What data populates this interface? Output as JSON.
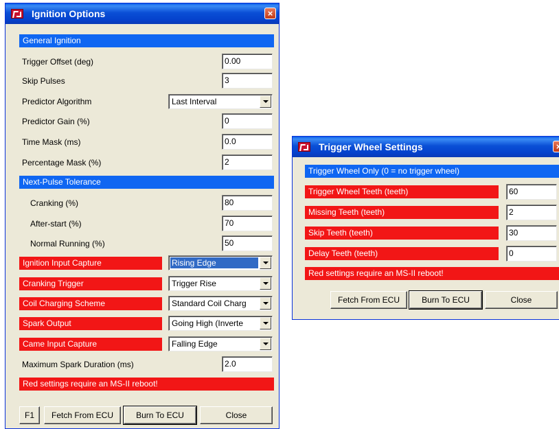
{
  "ignition": {
    "title": "Ignition Options",
    "close_glyph": "×",
    "general_header": "General Ignition",
    "trigger_offset": {
      "label": "Trigger Offset (deg)",
      "value": "0.00"
    },
    "skip_pulses": {
      "label": "Skip Pulses",
      "value": "3"
    },
    "predictor_algorithm": {
      "label": "Predictor Algorithm",
      "value": "Last Interval"
    },
    "predictor_gain": {
      "label": "Predictor Gain (%)",
      "value": "0"
    },
    "time_mask": {
      "label": "Time Mask (ms)",
      "value": "0.0"
    },
    "percentage_mask": {
      "label": "Percentage Mask (%)",
      "value": "2"
    },
    "tolerance_header": "Next-Pulse Tolerance",
    "cranking": {
      "label": "Cranking (%)",
      "value": "80"
    },
    "after_start": {
      "label": "After-start (%)",
      "value": "70"
    },
    "normal_running": {
      "label": "Normal Running (%)",
      "value": "50"
    },
    "ignition_input_capture": {
      "label": "Ignition Input Capture",
      "value": "Rising Edge"
    },
    "cranking_trigger": {
      "label": "Cranking Trigger",
      "value": "Trigger Rise"
    },
    "coil_charging_scheme": {
      "label": "Coil Charging Scheme",
      "value": "Standard Coil Charg"
    },
    "spark_output": {
      "label": "Spark Output",
      "value": "Going High (Inverte"
    },
    "came_input_capture": {
      "label": "Came Input Capture",
      "value": "Falling Edge"
    },
    "max_spark_duration": {
      "label": "Maximum Spark Duration (ms)",
      "value": "2.0"
    },
    "reboot_notice": "Red settings require an MS-II reboot!",
    "buttons": {
      "f1": "F1",
      "fetch": "Fetch From ECU",
      "burn": "Burn To ECU",
      "close": "Close"
    }
  },
  "trigger_wheel": {
    "title": "Trigger Wheel Settings",
    "close_glyph": "×",
    "header": "Trigger Wheel Only (0 = no trigger wheel)",
    "teeth": {
      "label": "Trigger Wheel Teeth (teeth)",
      "value": "60"
    },
    "missing": {
      "label": "Missing Teeth (teeth)",
      "value": "2"
    },
    "skip": {
      "label": "Skip Teeth (teeth)",
      "value": "30"
    },
    "delay": {
      "label": "Delay Teeth (teeth)",
      "value": "0"
    },
    "reboot_notice": "Red settings require an MS-II reboot!",
    "buttons": {
      "fetch": "Fetch From ECU",
      "burn": "Burn To ECU",
      "close": "Close"
    }
  },
  "colors": {
    "header_blue": "#0f66f2",
    "warning_red": "#f21616",
    "title_blue": "#0a4fd6",
    "window_bg": "#ece9d8"
  }
}
